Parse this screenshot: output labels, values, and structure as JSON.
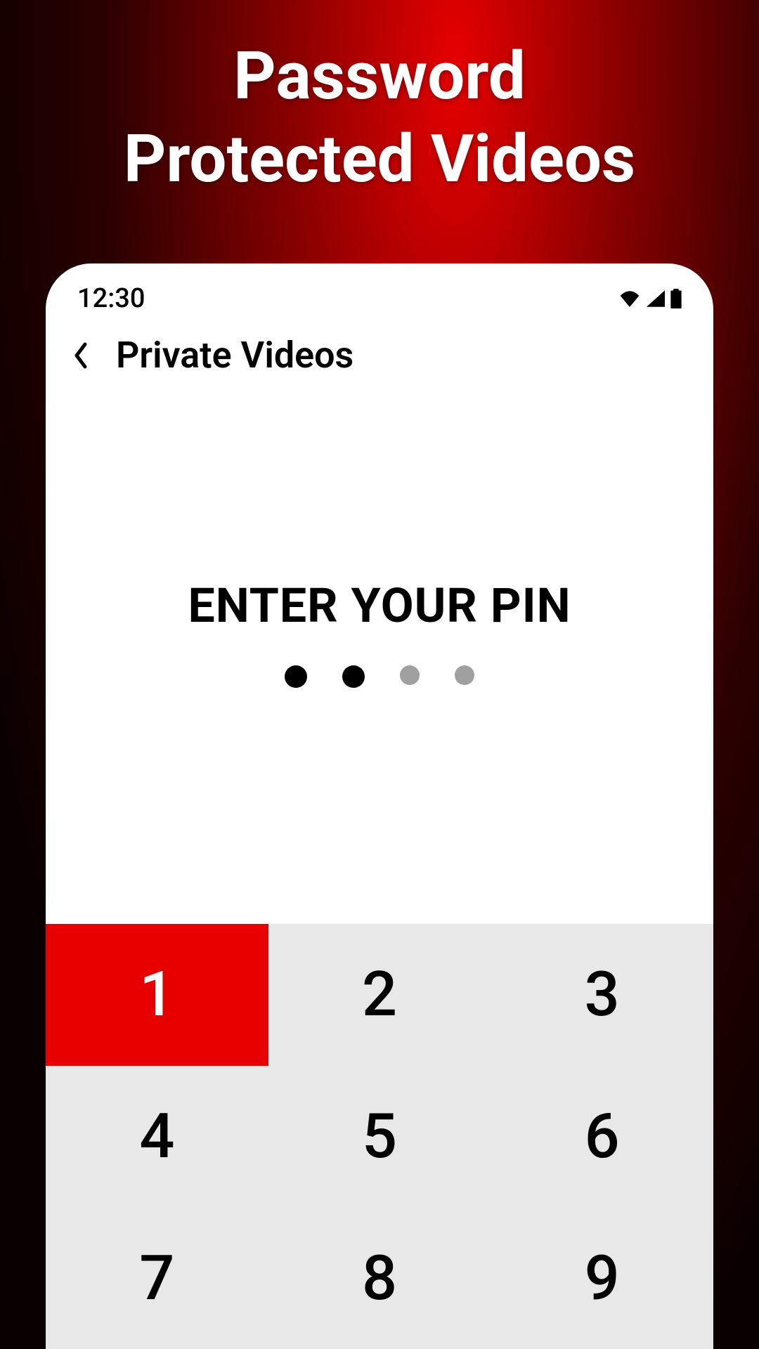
{
  "hero": {
    "title_line1": "Password",
    "title_line2": "Protected Videos"
  },
  "status_bar": {
    "time": "12:30"
  },
  "header": {
    "title": "Private Videos"
  },
  "pin": {
    "prompt": "ENTER YOUR PIN",
    "total_digits": 4,
    "filled_digits": 2
  },
  "keypad": {
    "keys": [
      "1",
      "2",
      "3",
      "4",
      "5",
      "6",
      "7",
      "8",
      "9"
    ],
    "active_key": "1"
  },
  "colors": {
    "accent": "#e60000",
    "background_dark": "#0a0000"
  }
}
